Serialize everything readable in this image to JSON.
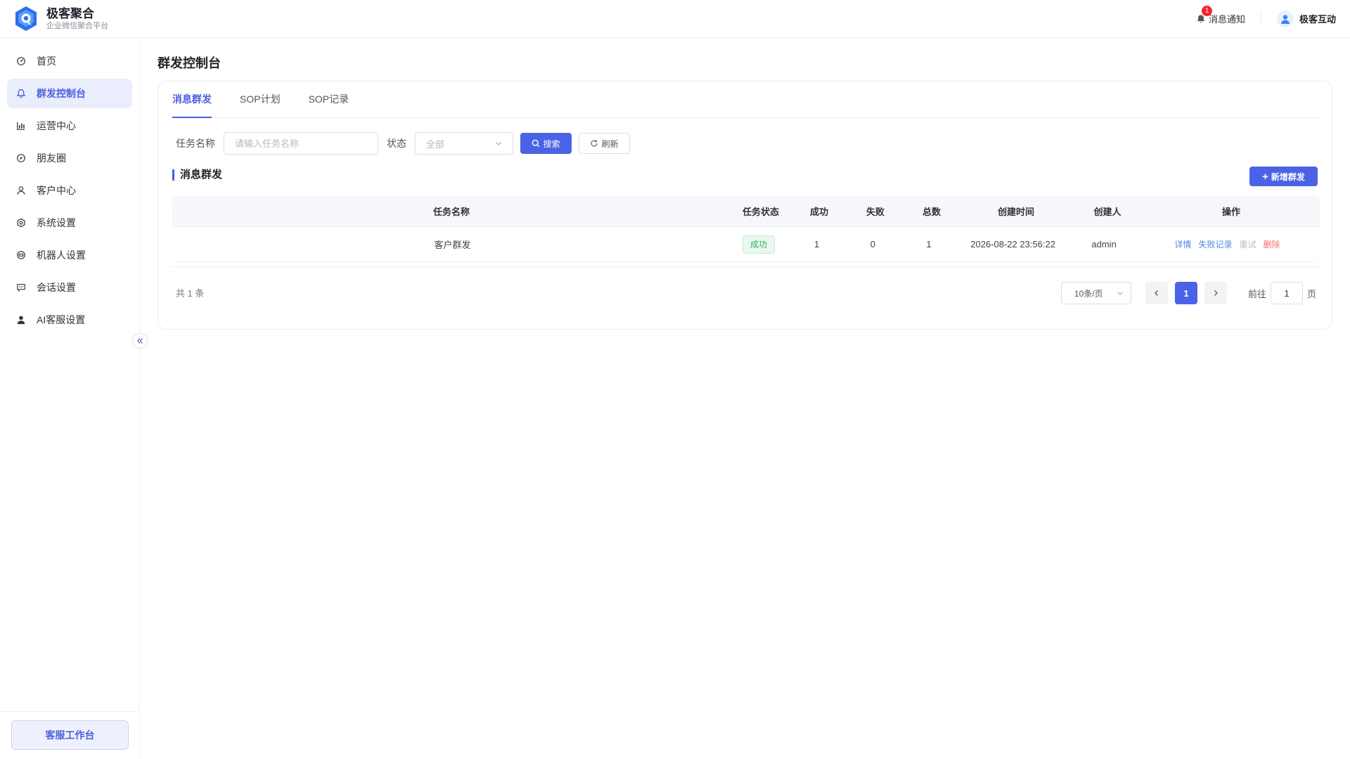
{
  "header": {
    "brand_name": "极客聚合",
    "brand_sub": "企业微信聚合平台",
    "notify_label": "消息通知",
    "notify_count": "1",
    "user_name": "极客互动"
  },
  "sidebar": {
    "items": [
      {
        "label": "首页",
        "icon": "dashboard-icon"
      },
      {
        "label": "群发控制台",
        "icon": "bell-icon"
      },
      {
        "label": "运营中心",
        "icon": "chart-icon"
      },
      {
        "label": "朋友圈",
        "icon": "compass-icon"
      },
      {
        "label": "客户中心",
        "icon": "user-icon"
      },
      {
        "label": "系统设置",
        "icon": "gear-icon"
      },
      {
        "label": "机器人设置",
        "icon": "robot-icon"
      },
      {
        "label": "会话设置",
        "icon": "chat-icon"
      },
      {
        "label": "AI客服设置",
        "icon": "person-icon"
      }
    ],
    "active_index": 1,
    "workbench_label": "客服工作台"
  },
  "page": {
    "title": "群发控制台",
    "tabs": [
      {
        "label": "消息群发",
        "active": true
      },
      {
        "label": "SOP计划",
        "active": false
      },
      {
        "label": "SOP记录",
        "active": false
      }
    ],
    "filters": {
      "task_name_label": "任务名称",
      "task_name_placeholder": "请输入任务名称",
      "status_label": "状态",
      "status_value": "全部",
      "search_label": "搜索",
      "refresh_label": "刷新"
    },
    "section_title": "消息群发",
    "add_label": "新增群发",
    "table": {
      "headers": [
        "任务名称",
        "任务状态",
        "成功",
        "失败",
        "总数",
        "创建时间",
        "创建人",
        "操作"
      ],
      "rows": [
        {
          "name": "客户群发",
          "status": "成功",
          "success": "1",
          "fail": "0",
          "total": "1",
          "created_at": "2026-08-22 23:56:22",
          "creator": "admin",
          "ops": {
            "detail": "详情",
            "fail_log": "失败记录",
            "retry": "重试",
            "delete": "删除"
          }
        }
      ]
    },
    "pagination": {
      "total_text": "共 1 条",
      "page_size": "10条/页",
      "current_page": "1",
      "goto_label": "前往",
      "goto_value": "1",
      "goto_suffix": "页"
    }
  },
  "colors": {
    "primary": "#4a63e6",
    "success": "#28b560",
    "danger": "#f56c6c",
    "link": "#4a86e8"
  }
}
